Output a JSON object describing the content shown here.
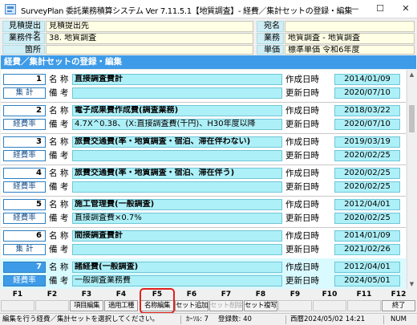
{
  "window": {
    "title": "SurveyPlan 委託業務積算システム Ver 7.11.5.1【地質調査】- 経費／集計セットの登録・編集",
    "minimize": "—",
    "maximize": "☐",
    "close": "✕"
  },
  "header": {
    "estimate_label": "見積提出先",
    "estimate_value": "見積提出先",
    "addressee_label": "宛名",
    "addressee_value": "",
    "project_label": "業務件名",
    "project_value": "38. 地質調査",
    "business_label": "業務",
    "business_value": "地質調査 - 地質調査",
    "location_label": "箇所",
    "location_value": "",
    "unit_label": "単価",
    "unit_value": "標準単価 令和6年度"
  },
  "section_title": "経費／集計セットの登録・編集",
  "labels": {
    "name": "名 称",
    "remarks": "備 考",
    "created": "作成日時",
    "updated": "更新日時"
  },
  "records": [
    {
      "num": "1",
      "type": "集 計",
      "name": "直接調査費計",
      "remarks": "",
      "created": "2014/01/09",
      "updated": "2020/07/10"
    },
    {
      "num": "2",
      "type": "経費率",
      "name": "電子成果費作成費(調査業務)",
      "remarks": "4.7X^0.38、(X:直接調査費(千円)、H30年度以降",
      "created": "2018/03/22",
      "updated": "2020/07/10"
    },
    {
      "num": "3",
      "type": "経費率",
      "name": "旅費交通費(率・地質調査・宿泊、滞在伴わない)",
      "remarks": "",
      "created": "2019/03/19",
      "updated": "2020/02/25"
    },
    {
      "num": "4",
      "type": "経費率",
      "name": "旅費交通費(率・地質調査・宿泊、滞在伴う)",
      "remarks": "",
      "created": "2020/02/25",
      "updated": "2020/02/25"
    },
    {
      "num": "5",
      "type": "経費率",
      "name": "施工管理費(一般調査)",
      "remarks": "直接調査費×0.7%",
      "created": "2012/04/01",
      "updated": "2020/02/25"
    },
    {
      "num": "6",
      "type": "集 計",
      "name": "間接調査費計",
      "remarks": "",
      "created": "2014/01/09",
      "updated": "2021/02/26"
    },
    {
      "num": "7",
      "type": "経費率",
      "name": "諸経費(一般調査)",
      "remarks": "一般調査業務費",
      "created": "2012/04/01",
      "updated": "2024/05/01"
    }
  ],
  "function_keys": [
    {
      "key": "F1",
      "label": "",
      "state": "empty"
    },
    {
      "key": "F2",
      "label": "",
      "state": "empty"
    },
    {
      "key": "F3",
      "label": "項目編集",
      "state": "enabled"
    },
    {
      "key": "F4",
      "label": "適用工種",
      "state": "enabled"
    },
    {
      "key": "F5",
      "label": "名称編集",
      "state": "enabled"
    },
    {
      "key": "F6",
      "label": "セット追加",
      "state": "enabled"
    },
    {
      "key": "F7",
      "label": "セット削除",
      "state": "disabled"
    },
    {
      "key": "F8",
      "label": "セット複写",
      "state": "enabled"
    },
    {
      "key": "F9",
      "label": "",
      "state": "empty"
    },
    {
      "key": "F10",
      "label": "",
      "state": "empty"
    },
    {
      "key": "F11",
      "label": "",
      "state": "empty"
    },
    {
      "key": "F12",
      "label": "終了",
      "state": "enabled"
    }
  ],
  "status": {
    "message": "編集を行う経費／集計セットを選択してください。",
    "cursor": "ｶｰｿﾙ: 7",
    "count": "登録数: 40",
    "datetime": "西暦2024/05/02 14:21",
    "num": "NUM"
  },
  "colors": {
    "section_bar": "#3e9be8",
    "field_bg": "#aef0f8",
    "selected_row": "#d9faff",
    "highlight_border": "#e0221c"
  }
}
